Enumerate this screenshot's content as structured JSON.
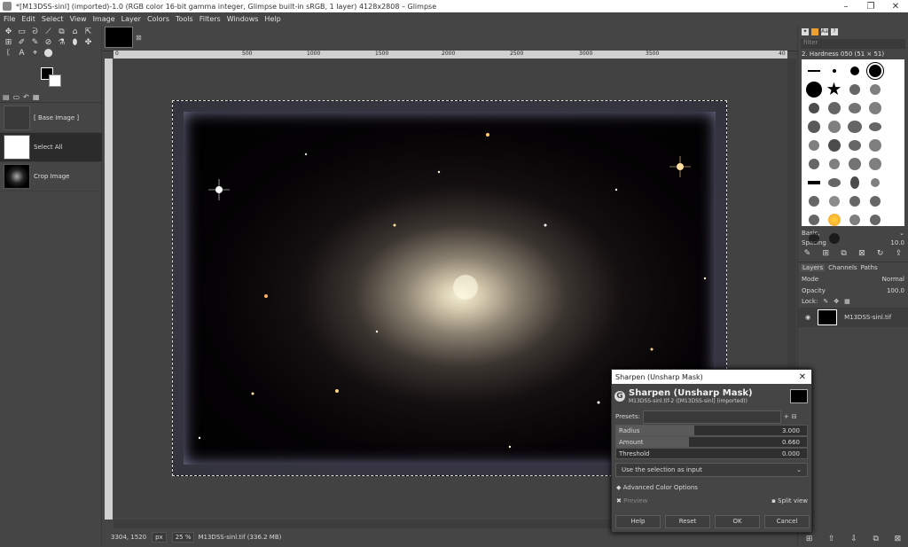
{
  "window": {
    "title": "*[M13DSS-sinl] (imported)-1.0 (RGB color 16-bit gamma integer, Glimpse built-in sRGB, 1 layer) 4128x2808 – Glimpse",
    "minimize": "–",
    "maximize": "❐",
    "close": "✕"
  },
  "menu": [
    "File",
    "Edit",
    "Select",
    "View",
    "Image",
    "Layer",
    "Colors",
    "Tools",
    "Filters",
    "Windows",
    "Help"
  ],
  "tools": [
    "✥",
    "▭",
    "ᘐ",
    "⟋",
    "⧉",
    "⌂",
    "⇱",
    "⊞",
    "✐",
    "✎",
    "⊘",
    "⚗",
    "⬮",
    "✤",
    "ᛕ",
    "A",
    "⌖",
    "⬤"
  ],
  "history": [
    {
      "label": "[ Base Image ]"
    },
    {
      "label": "Select All"
    },
    {
      "label": "Crop Image"
    }
  ],
  "ruler": [
    "0",
    "500",
    "1000",
    "1500",
    "2000",
    "2500",
    "3000",
    "3500",
    "40"
  ],
  "status": {
    "coords": "3304, 1520",
    "unit": "px",
    "zoom": "25 %",
    "file": "M13DSS-sinl.tif (336.2 MB)"
  },
  "brushes": {
    "filter": "filter",
    "current": "2. Hardness 050 (51 × 51)",
    "preset": "Basic,",
    "spacing_label": "Spacing",
    "spacing_value": "10.0"
  },
  "layers": {
    "tabs": [
      "Layers",
      "Channels",
      "Paths"
    ],
    "mode_label": "Mode",
    "mode_value": "Normal",
    "opacity_label": "Opacity",
    "opacity_value": "100.0",
    "lock_label": "Lock:",
    "layer_name": "M13DSS-sinl.tif"
  },
  "dialog": {
    "title": "Sharpen (Unsharp Mask)",
    "heading": "Sharpen (Unsharp Mask)",
    "subheading": "M13DSS-sinl.tif-2 ([M13DSS-sinl] (imported))",
    "presets_label": "Presets:",
    "radius_label": "Radius",
    "radius_value": "3.000",
    "radius_fill": 0.41,
    "amount_label": "Amount",
    "amount_value": "0.660",
    "amount_fill": 0.38,
    "threshold_label": "Threshold",
    "threshold_value": "0.000",
    "input_option": "Use the selection as input",
    "advanced": "Advanced Color Options",
    "preview": "Preview",
    "split": "Split view",
    "help": "Help",
    "reset": "Reset",
    "ok": "OK",
    "cancel": "Cancel"
  }
}
